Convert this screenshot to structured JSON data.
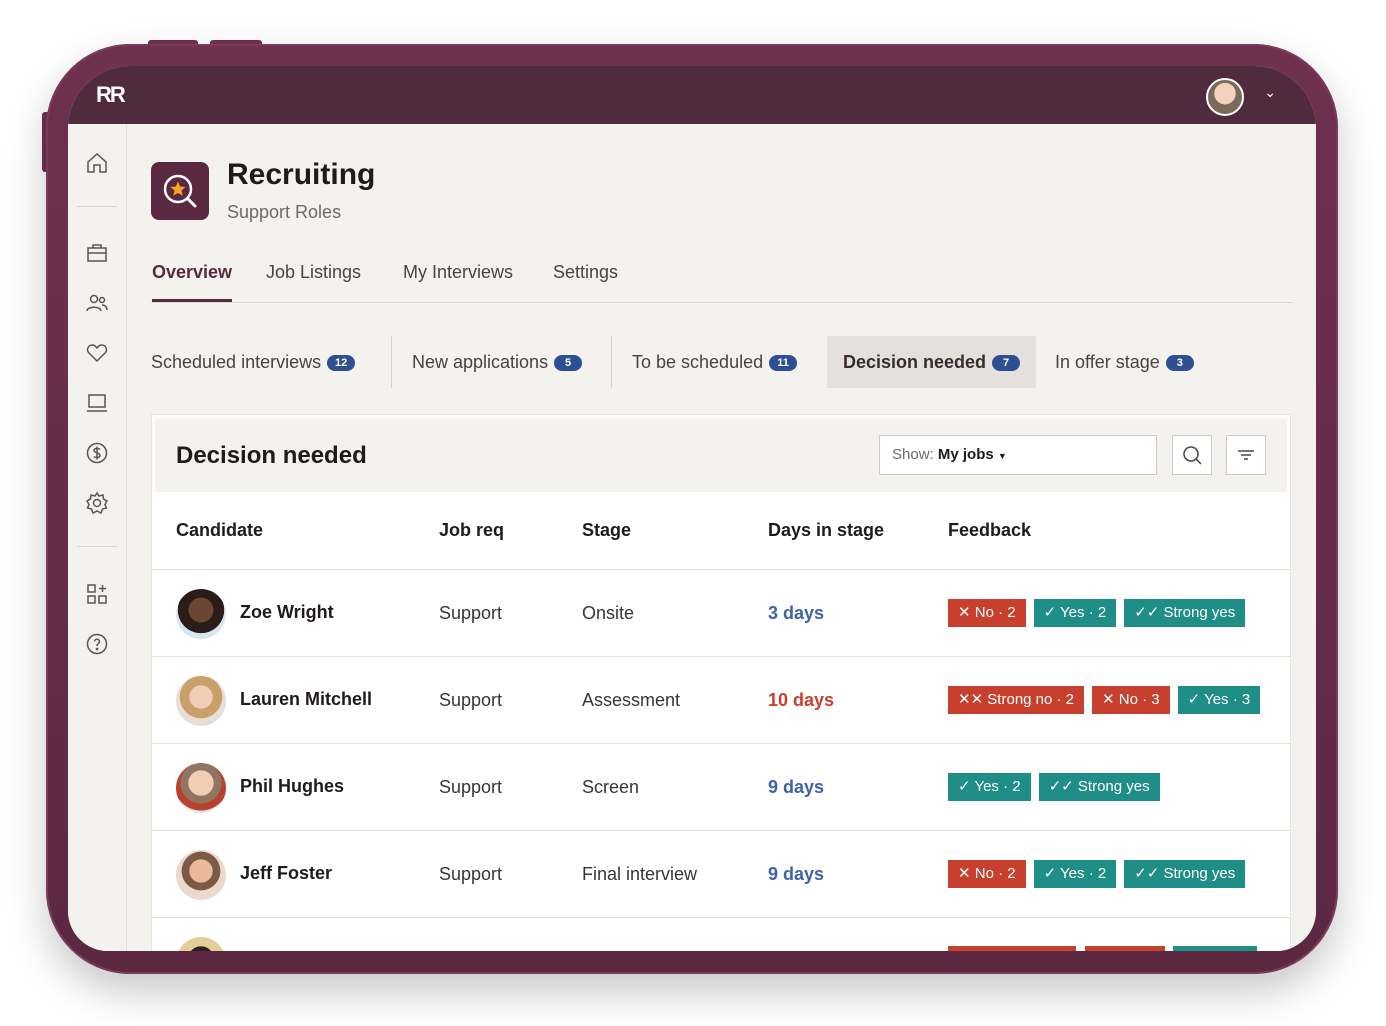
{
  "app": {
    "logo": "RR",
    "title": "Recruiting",
    "subtitle": "Support Roles"
  },
  "nav_tabs": [
    {
      "label": "Overview"
    },
    {
      "label": "Job Listings"
    },
    {
      "label": "My Interviews"
    },
    {
      "label": "Settings"
    }
  ],
  "stages": [
    {
      "label": "Scheduled interviews",
      "count": "12"
    },
    {
      "label": "New applications",
      "count": "5"
    },
    {
      "label": "To be scheduled",
      "count": "11"
    },
    {
      "label": "Decision needed",
      "count": "7"
    },
    {
      "label": "In offer stage",
      "count": "3"
    }
  ],
  "panel": {
    "title": "Decision needed",
    "show_prefix": "Show:",
    "show_value": "My jobs"
  },
  "columns": [
    "Candidate",
    "Job req",
    "Stage",
    "Days in stage",
    "Feedback"
  ],
  "rows": [
    {
      "name": "Zoe Wright",
      "job": "Support",
      "stage": "Onsite",
      "days": "3 days",
      "tags": [
        "✕ No · 2",
        "✓ Yes · 2",
        "✓✓ Strong yes"
      ]
    },
    {
      "name": "Lauren Mitchell",
      "job": "Support",
      "stage": "Assessment",
      "days": "10 days",
      "tags": [
        "✕✕ Strong no · 2",
        "✕ No · 3",
        "✓ Yes · 3"
      ]
    },
    {
      "name": "Phil Hughes",
      "job": "Support",
      "stage": "Screen",
      "days": "9 days",
      "tags": [
        "✓ Yes · 2",
        "✓✓ Strong yes"
      ]
    },
    {
      "name": "Jeff Foster",
      "job": "Support",
      "stage": "Final interview",
      "days": "9 days",
      "tags": [
        "✕ No · 2",
        "✓ Yes · 2",
        "✓✓ Strong yes"
      ]
    }
  ],
  "colors": {
    "brand": "#5a2840",
    "days_normal": "#3f63a8",
    "days_overdue": "#c7402e",
    "tag_no": "#c7402e",
    "tag_yes": "#1f8e86",
    "badge": "#2f4f93"
  }
}
